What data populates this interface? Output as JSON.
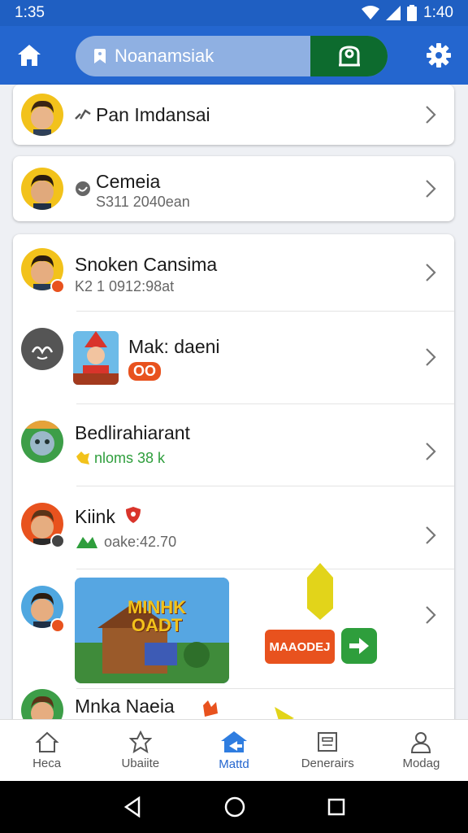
{
  "status_bar": {
    "time_left": "1:35",
    "time_right": "1:40"
  },
  "search": {
    "text": "Noanamsiak"
  },
  "items": [
    {
      "title": "Pan Imdansai",
      "subtitle": ""
    },
    {
      "title": "Cemeia",
      "subtitle": "S311 2040ean"
    },
    {
      "title": "Snoken Cansima",
      "subtitle": "K2 1 0912:98at"
    },
    {
      "title": "Mak: daeni",
      "badge": "OO"
    },
    {
      "title": "Bedlirahiarant",
      "subtitle": "nloms 38 k"
    },
    {
      "title": "Kiink",
      "subtitle": "oake:42.70"
    },
    {
      "game_title": "MINHK OADT",
      "button_label": "MAAODEJ"
    },
    {
      "title": "Mnka Naeia"
    }
  ],
  "bottom_nav": [
    {
      "label": "Heca"
    },
    {
      "label": "Ubaiite"
    },
    {
      "label": "Mattd"
    },
    {
      "label": "Denerairs"
    },
    {
      "label": "Modag"
    }
  ],
  "colors": {
    "primary": "#2466cf",
    "status": "#1f5fc2",
    "green": "#0d6b2e",
    "accent_green": "#2e9e3c",
    "accent_orange": "#e8521e"
  }
}
